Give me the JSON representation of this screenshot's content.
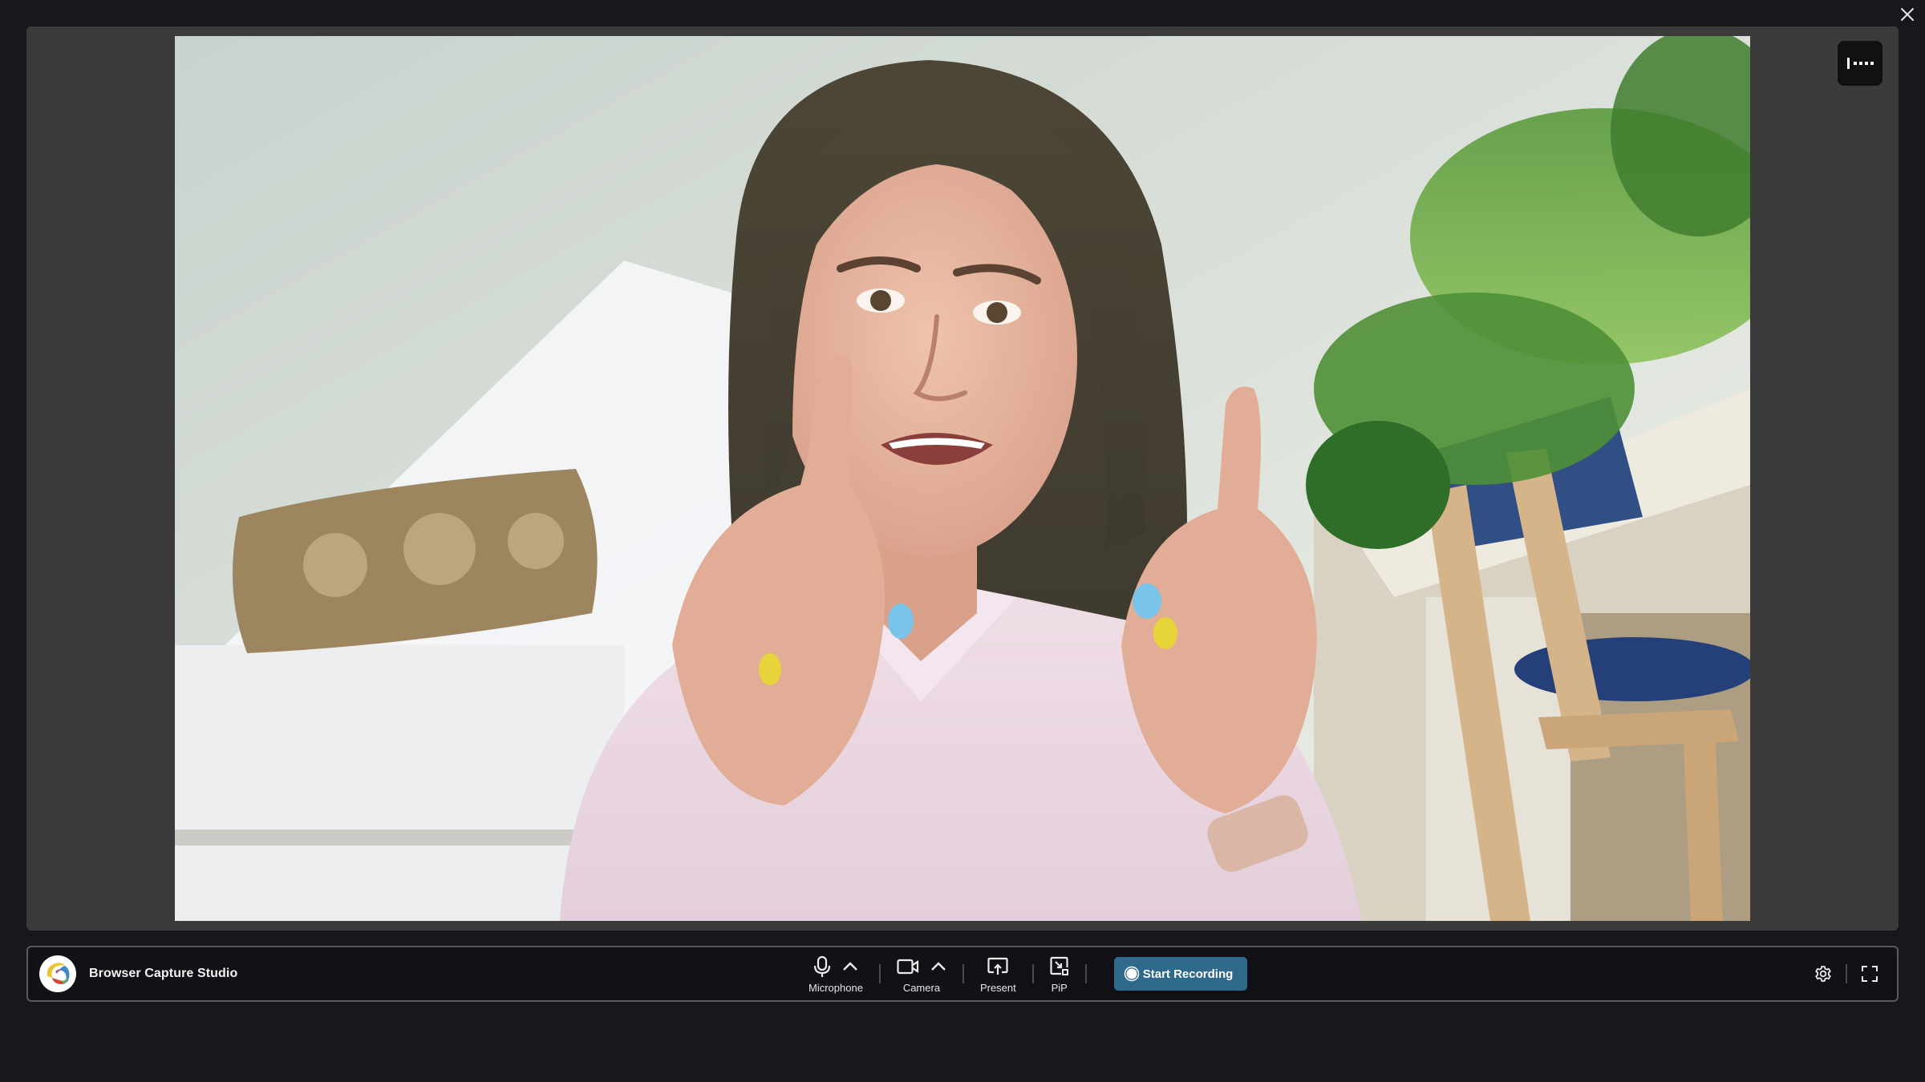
{
  "window": {
    "close_icon": "close-icon"
  },
  "stage": {
    "video_description": "Camera preview: woman with shoulder-length brown hair in a pink striped shirt gesturing with raised index fingers, room with plants and a wooden chair in the background",
    "audio_level_icon": "audio-level-icon"
  },
  "toolbar": {
    "app_name": "Browser Capture Studio",
    "logo_icon": "app-logo-icon",
    "controls": [
      {
        "label": "Microphone",
        "icon": "microphone-icon",
        "has_options": true
      },
      {
        "label": "Camera",
        "icon": "camera-icon",
        "has_options": true
      },
      {
        "label": "Present",
        "icon": "present-screen-icon",
        "has_options": false
      },
      {
        "label": "PiP",
        "icon": "picture-in-picture-icon",
        "has_options": false
      }
    ],
    "record_button": {
      "label": "Start Recording",
      "icon": "record-icon"
    },
    "settings_icon": "gear-icon",
    "fullscreen_icon": "fullscreen-icon"
  },
  "colors": {
    "background": "#17181d",
    "stage": "#3b3b3b",
    "toolbar": "#121216",
    "record_button": "#2f6a8c"
  }
}
